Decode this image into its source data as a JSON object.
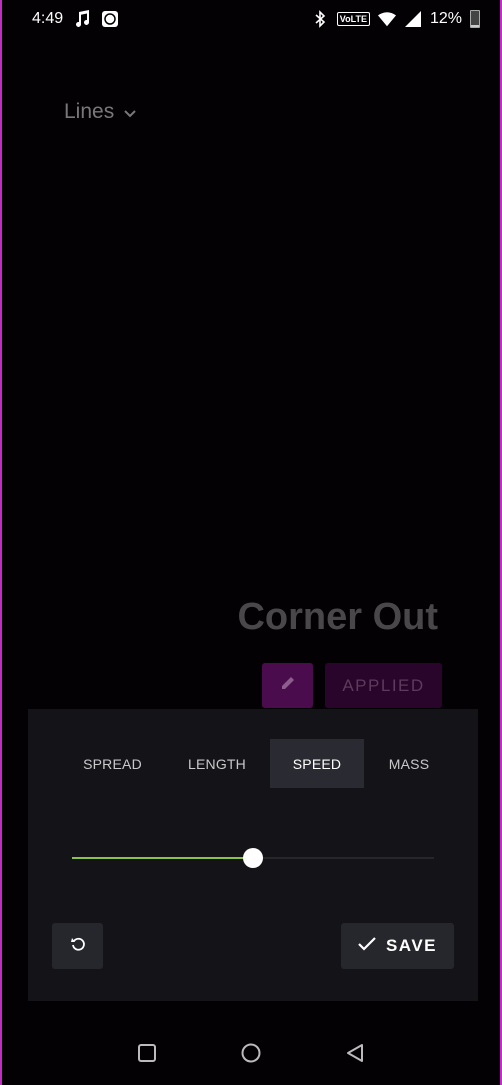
{
  "status_bar": {
    "time": "4:49",
    "battery": "12%",
    "network_label": "VoLTE",
    "icons": [
      "music-note-icon",
      "app-notification-icon",
      "bluetooth-icon",
      "volte-icon",
      "wifi-icon",
      "signal-icon",
      "battery-icon"
    ]
  },
  "header": {
    "category_label": "Lines"
  },
  "preview": {
    "title": "Corner Out",
    "applied_label": "APPLIED"
  },
  "panel": {
    "tabs": [
      {
        "label": "SPREAD",
        "selected": false
      },
      {
        "label": "LENGTH",
        "selected": false
      },
      {
        "label": "SPEED",
        "selected": true
      },
      {
        "label": "MASS",
        "selected": false
      }
    ],
    "slider": {
      "value_fraction": 0.5,
      "fill_color": "#8bc34a"
    },
    "save_label": "SAVE"
  },
  "colors": {
    "accent_border": "#c42cc6",
    "edit_button": "#4b0c4d",
    "applied_button": "#2a052b",
    "panel_bg": "#141418",
    "selected_tab_bg": "#2a2a32"
  }
}
